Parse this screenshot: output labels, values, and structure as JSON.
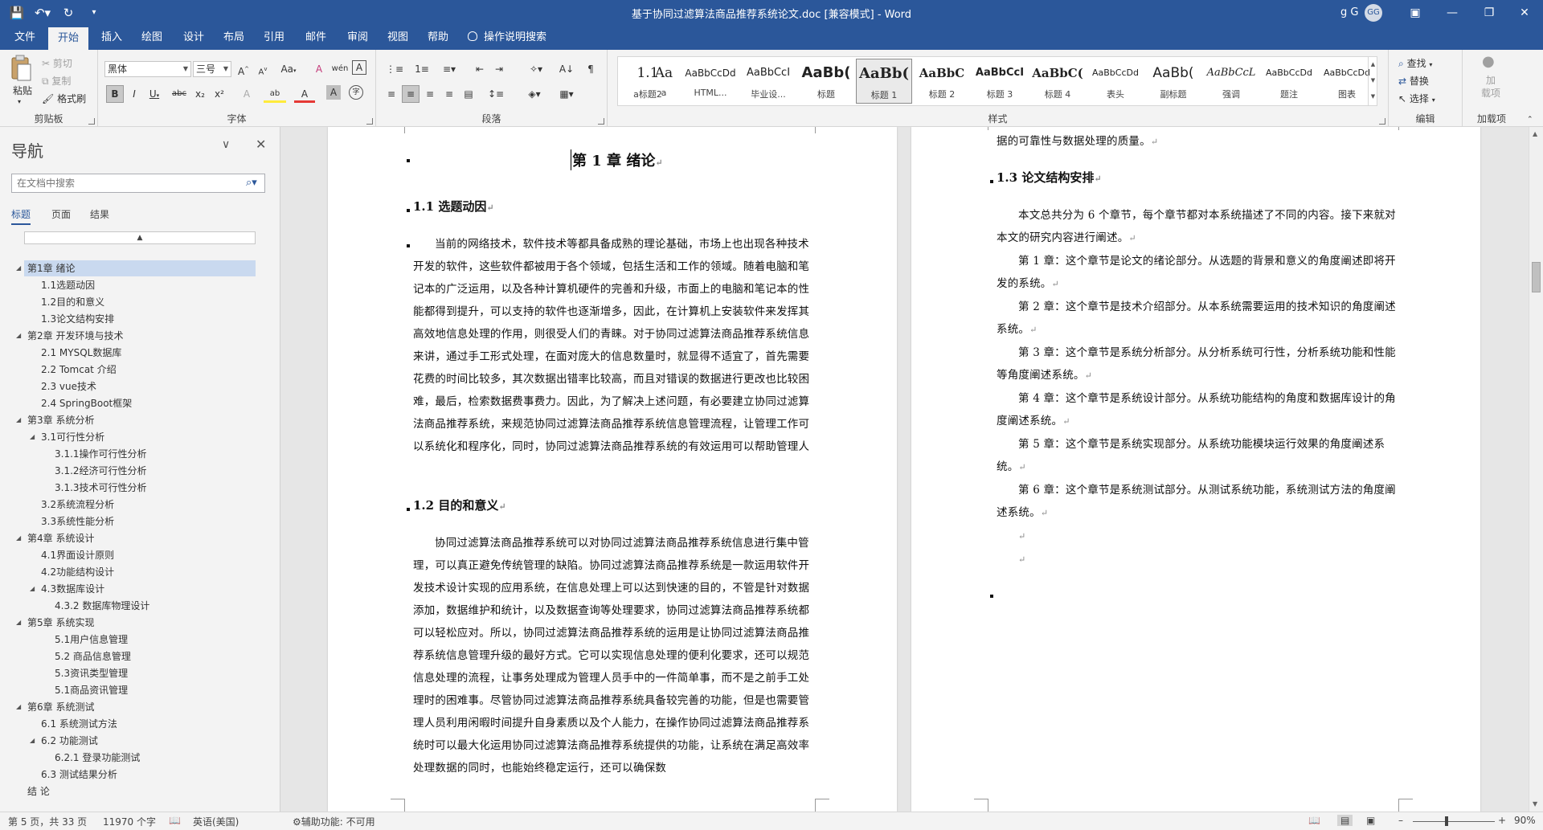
{
  "window": {
    "title": "基于协同过滤算法商品推荐系统论文.doc [兼容模式] - Word",
    "user_name": "g G",
    "avatar_initials": "GG",
    "controls": [
      "restore-ribbon-icon",
      "minimize-icon",
      "maximize-icon",
      "close-icon"
    ]
  },
  "tabs": [
    "文件",
    "开始",
    "插入",
    "绘图",
    "设计",
    "布局",
    "引用",
    "邮件",
    "审阅",
    "视图",
    "帮助"
  ],
  "active_tab": "开始",
  "tell_me": "操作说明搜索",
  "ribbon": {
    "clipboard": {
      "label": "剪贴板",
      "paste": "粘贴",
      "cut": "剪切",
      "copy": "复制",
      "format_painter": "格式刷"
    },
    "font": {
      "label": "字体",
      "font_name": "黑体",
      "font_size": "三号",
      "case_button": "Aa",
      "bold": "B",
      "italic": "I",
      "underline": "U",
      "strike": "abc",
      "subscript": "x₂",
      "superscript": "x²",
      "char_shading": "A",
      "char_border": "A",
      "grow": "A",
      "shrink": "A",
      "clear": "A",
      "highlight": "ab",
      "font_color": "A",
      "phonetic": "wén",
      "enclose": "字"
    },
    "paragraph": {
      "label": "段落"
    },
    "styles": {
      "label": "样式",
      "items": [
        {
          "preview": "1.1",
          "name": "a标题2"
        },
        {
          "preview": "Aa",
          "name": "a"
        },
        {
          "preview": "AaBbCcDd",
          "name": "HTML..."
        },
        {
          "preview": "AaBbCcI",
          "name": "毕业设..."
        },
        {
          "preview": "AaBb(",
          "name": "标题"
        },
        {
          "preview": "AaBb(",
          "name": "标题 1"
        },
        {
          "preview": "AaBbC",
          "name": "标题 2"
        },
        {
          "preview": "AaBbCcI",
          "name": "标题 3"
        },
        {
          "preview": "AaBbC(",
          "name": "标题 4"
        },
        {
          "preview": "AaBbCcDd",
          "name": "表头"
        },
        {
          "preview": "AaBb(",
          "name": "副标题"
        },
        {
          "preview": "AaBbCcL",
          "name": "强调"
        },
        {
          "preview": "AaBbCcDd",
          "name": "题注"
        },
        {
          "preview": "AaBbCcDd",
          "name": "图表"
        }
      ]
    },
    "editing": {
      "label": "编辑",
      "find": "查找",
      "replace": "替换",
      "select": "选择"
    },
    "addins": {
      "label": "加载项",
      "button": "加\n载项"
    }
  },
  "nav": {
    "title": "导航",
    "search_placeholder": "在文档中搜索",
    "tabs": [
      "标题",
      "页面",
      "结果"
    ],
    "collapse_bar": "▲",
    "items": [
      {
        "text": "第1章 绪论",
        "level": 1,
        "caret": true
      },
      {
        "text": "1.1选题动因",
        "level": 2
      },
      {
        "text": "1.2目的和意义",
        "level": 2
      },
      {
        "text": "1.3论文结构安排",
        "level": 2
      },
      {
        "text": "第2章 开发环境与技术",
        "level": 1,
        "caret": true
      },
      {
        "text": "2.1 MYSQL数据库",
        "level": 2
      },
      {
        "text": "2.2 Tomcat 介绍",
        "level": 2
      },
      {
        "text": "2.3 vue技术",
        "level": 2
      },
      {
        "text": "2.4 SpringBoot框架",
        "level": 2
      },
      {
        "text": "第3章 系统分析",
        "level": 1,
        "caret": true
      },
      {
        "text": "3.1可行性分析",
        "level": 2,
        "caret": true
      },
      {
        "text": "3.1.1操作可行性分析",
        "level": 3
      },
      {
        "text": "3.1.2经济可行性分析",
        "level": 3
      },
      {
        "text": "3.1.3技术可行性分析",
        "level": 3
      },
      {
        "text": "3.2系统流程分析",
        "level": 2
      },
      {
        "text": "3.3系统性能分析",
        "level": 2
      },
      {
        "text": "第4章 系统设计",
        "level": 1,
        "caret": true
      },
      {
        "text": "4.1界面设计原则",
        "level": 2
      },
      {
        "text": "4.2功能结构设计",
        "level": 2
      },
      {
        "text": "4.3数据库设计",
        "level": 2,
        "caret": true
      },
      {
        "text": "4.3.2 数据库物理设计",
        "level": 3
      },
      {
        "text": "第5章 系统实现",
        "level": 1,
        "caret": true
      },
      {
        "text": "5.1用户信息管理",
        "level": 3
      },
      {
        "text": "5.2 商品信息管理",
        "level": 3
      },
      {
        "text": "5.3资讯类型管理",
        "level": 3
      },
      {
        "text": "5.1商品资讯管理",
        "level": 3
      },
      {
        "text": "第6章 系统测试",
        "level": 1,
        "caret": true
      },
      {
        "text": "6.1 系统测试方法",
        "level": 2
      },
      {
        "text": "6.2 功能测试",
        "level": 2,
        "caret": true
      },
      {
        "text": "6.2.1 登录功能测试",
        "level": 3
      },
      {
        "text": "6.3 测试结果分析",
        "level": 2
      },
      {
        "text": "结 论",
        "level": 1
      }
    ]
  },
  "page1": {
    "chapter_title": "第 1 章  绪论",
    "h_1_1": "1.1 选题动因",
    "p_1_1": "当前的网络技术，软件技术等都具备成熟的理论基础，市场上也出现各种技术开发的软件，这些软件都被用于各个领域，包括生活和工作的领域。随着电脑和笔记本的广泛运用，以及各种计算机硬件的完善和升级，市面上的电脑和笔记本的性能都得到提升，可以支持的软件也逐渐增多，因此，在计算机上安装软件来发挥其高效地信息处理的作用，则很受人们的青睐。对于协同过滤算法商品推荐系统信息来讲，通过手工形式处理，在面对庞大的信息数量时，就显得不适宜了，首先需要花费的时间比较多，其次数据出错率比较高，而且对错误的数据进行更改也比较困难，最后，检索数据费事费力。因此，为了解决上述问题，有必要建立协同过滤算法商品推荐系统，来规范协同过滤算法商品推荐系统信息管理流程，让管理工作可以系统化和程序化，同时，协同过滤算法商品推荐系统的有效运用可以帮助管理人员准确快速地处理信息。",
    "h_1_2": "1.2 目的和意义",
    "p_1_2": "协同过滤算法商品推荐系统可以对协同过滤算法商品推荐系统信息进行集中管理，可以真正避免传统管理的缺陷。协同过滤算法商品推荐系统是一款运用软件开发技术设计实现的应用系统，在信息处理上可以达到快速的目的，不管是针对数据添加，数据维护和统计，以及数据查询等处理要求，协同过滤算法商品推荐系统都可以轻松应对。所以，协同过滤算法商品推荐系统的运用是让协同过滤算法商品推荐系统信息管理升级的最好方式。它可以实现信息处理的便利化要求，还可以规范信息处理的流程，让事务处理成为管理人员手中的一件简单事，而不是之前手工处理时的困难事。尽管协同过滤算法商品推荐系统具备较完善的功能，但是也需要管理人员利用闲暇时间提升自身素质以及个人能力，在操作协同过滤算法商品推荐系统时可以最大化运用协同过滤算法商品推荐系统提供的功能，让系统在满足高效率处理数据的同时，也能始终稳定运行，还可以确保数"
  },
  "page2": {
    "p_cont": "据的可靠性与数据处理的质量。",
    "h_1_3": "1.3 论文结构安排",
    "paras": [
      "本文总共分为 6 个章节，每个章节都对本系统描述了不同的内容。接下来就对本文的研究内容进行阐述。",
      "第 1 章：这个章节是论文的绪论部分。从选题的背景和意义的角度阐述即将开发的系统。",
      "第 2 章：这个章节是技术介绍部分。从本系统需要运用的技术知识的角度阐述系统。",
      "第 3 章：这个章节是系统分析部分。从分析系统可行性，分析系统功能和性能等角度阐述系统。",
      "第 4 章：这个章节是系统设计部分。从系统功能结构的角度和数据库设计的角度阐述系统。",
      "第 5 章：这个章节是系统实现部分。从系统功能模块运行效果的角度阐述系统。",
      "第 6 章：这个章节是系统测试部分。从测试系统功能，系统测试方法的角度阐述系统。"
    ],
    "para_mark": "↵"
  },
  "status": {
    "page": "第 5 页，共 33 页",
    "words": "11970 个字",
    "language": "英语(美国)",
    "accessibility": "辅助功能: 不可用",
    "zoom": "90%"
  }
}
